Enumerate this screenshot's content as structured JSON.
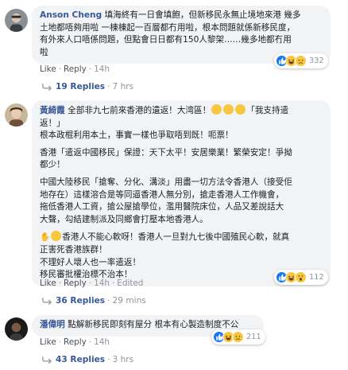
{
  "comments": [
    {
      "author": "Anson Cheng",
      "text_lines": [
        "填海終有一日會填飽，但新移民永無止境地來港 幾多",
        "土地都唔夠用啦 一棟棟起一百層都冇用啦，根本問題就係新移民度，",
        "有外來人口唔係問題，但點會日日都有150人黎架……幾多地都冇用",
        "啦"
      ],
      "actions": {
        "like": "Like",
        "reply": "Reply",
        "time": "14h"
      },
      "reactions": {
        "icons": [
          "like-icon",
          "haha-icon",
          "sad-icon"
        ],
        "count": "332"
      },
      "replies": {
        "label": "19 Replies",
        "time": "7 hrs"
      }
    },
    {
      "author": "黃綺霞",
      "paragraphs": [
        [
          "全部非九七前來香港的遺返！大湾區！",
          "「我支持遣",
          "返！」",
          "根本政棍利用本土，事實一樣也爭取唔到既！呃票！"
        ],
        [
          "香港「遣返中國移民」保證：天下太平！安居樂業！繁榮安定！爭拗",
          "都少！"
        ],
        [
          "中國大陸移民「搶奪、分化、溝淡」用盡一切方法令香港人（接受佢",
          "地存在）這樣溶合是等同逼香港人無分別，搶走香港人工作機會，",
          "拖低香港人工資，搶公屋搶學位，濫用醫院床位，人品又差說話大",
          "大聲，勾結建制派及同鄉會打壓本地香港人。"
        ],
        [
          "香港人不能心軟呀！香港人一旦對九七後中國殖民心軟，就真",
          "正害死香港族群！",
          "不理好人壞人也一率遣返！",
          "移民審批權治標不治本！"
        ]
      ],
      "actions": {
        "like": "Like",
        "reply": "Reply",
        "time": "14h",
        "edited": "Edited"
      },
      "reactions": {
        "icons": [
          "like-icon",
          "haha-icon",
          "wow-icon"
        ],
        "count": "112"
      },
      "replies": {
        "label": "36 Replies",
        "time": "29 mins"
      }
    },
    {
      "author": "潘偉明",
      "text_lines": [
        "點解新移民即刻有屋分 根本有心製造制度不公"
      ],
      "actions": {
        "like": "Like",
        "reply": "Reply",
        "time": "14h"
      },
      "reactions": {
        "icons": [
          "like-icon",
          "haha-icon",
          "sad-icon"
        ],
        "count": "211"
      },
      "replies": {
        "label": "43 Replies",
        "time": "3 hrs"
      }
    }
  ],
  "colors": {
    "link": "#385898",
    "bubble": "#f2f3f5",
    "meta": "#90949c",
    "like_blue": "#1877f2",
    "emoji_yellow": "#f7c83f"
  }
}
